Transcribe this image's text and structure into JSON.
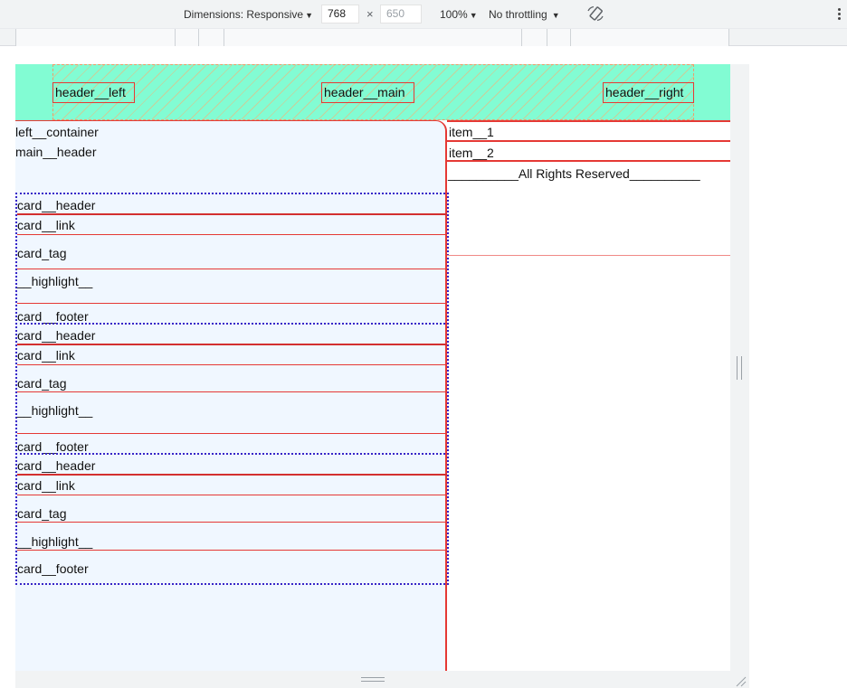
{
  "toolbar": {
    "dimensions_label": "Dimensions: Responsive",
    "width_value": "768",
    "times": "×",
    "height_placeholder": "650",
    "zoom": "100%",
    "throttling": "No throttling",
    "dropdown_glyph": "▼"
  },
  "page": {
    "header": {
      "left": "header__left",
      "main": "header__main",
      "right": "header__right"
    },
    "left_container": {
      "label": "left__container",
      "main_header": "main__header",
      "cards": [
        {
          "header": "card__header",
          "link": "card__link",
          "tag": "card_tag",
          "highlight": "__highlight__",
          "footer": "card__footer"
        },
        {
          "header": "card__header",
          "link": "card__link",
          "tag": "card_tag",
          "highlight": "__highlight__",
          "footer": "card__footer"
        },
        {
          "header": "card__header",
          "link": "card__link",
          "tag": "card_tag",
          "highlight": "__highlight__",
          "footer": "card__footer"
        }
      ]
    },
    "right": {
      "items": [
        "item__1",
        "item__2"
      ],
      "footer_text": "__________All Rights Reserved__________"
    }
  },
  "colors": {
    "header_bg": "#82fcd3",
    "container_bg": "#f0f7ff",
    "border_red": "#e53935",
    "card_dotted": "#3725c8"
  },
  "icons": {
    "rotate": "rotate-icon",
    "more": "more-vertical-icon",
    "resize": "resize-handle-icon"
  }
}
